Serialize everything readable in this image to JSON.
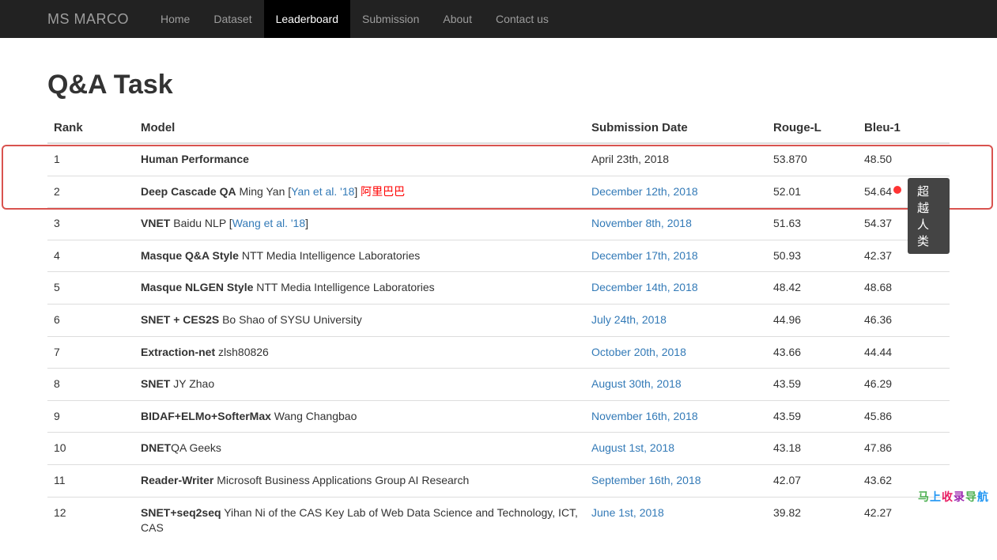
{
  "brand": "MS MARCO",
  "nav": [
    {
      "label": "Home",
      "active": false
    },
    {
      "label": "Dataset",
      "active": false
    },
    {
      "label": "Leaderboard",
      "active": true
    },
    {
      "label": "Submission",
      "active": false
    },
    {
      "label": "About",
      "active": false
    },
    {
      "label": "Contact us",
      "active": false
    }
  ],
  "page_title": "Q&A Task",
  "columns": {
    "rank": "Rank",
    "model": "Model",
    "date": "Submission Date",
    "rouge": "Rouge-L",
    "bleu": "Bleu-1"
  },
  "rows": [
    {
      "rank": "1",
      "model_name": "Human Performance",
      "model_rest": "",
      "paper": "",
      "extra_cn": "",
      "date": "April 23th, 2018",
      "date_link": false,
      "rouge": "53.870",
      "bleu": "48.50"
    },
    {
      "rank": "2",
      "model_name": "Deep Cascade QA",
      "model_rest": " Ming Yan [",
      "paper": "Yan et al. '18",
      "paper_close": "]   ",
      "extra_cn": "阿里巴巴",
      "date": "December 12th, 2018",
      "date_link": true,
      "rouge": "52.01",
      "bleu": "54.64"
    },
    {
      "rank": "3",
      "model_name": "VNET",
      "model_rest": " Baidu NLP [",
      "paper": "Wang et al. '18",
      "paper_close": "]",
      "extra_cn": "",
      "date": "November 8th, 2018",
      "date_link": true,
      "rouge": "51.63",
      "bleu": "54.37"
    },
    {
      "rank": "4",
      "model_name": "Masque Q&A Style",
      "model_rest": " NTT Media Intelligence Laboratories",
      "paper": "",
      "extra_cn": "",
      "date": "December 17th, 2018",
      "date_link": true,
      "rouge": "50.93",
      "bleu": "42.37"
    },
    {
      "rank": "5",
      "model_name": "Masque NLGEN Style",
      "model_rest": " NTT Media Intelligence Laboratories",
      "paper": "",
      "extra_cn": "",
      "date": "December 14th, 2018",
      "date_link": true,
      "rouge": "48.42",
      "bleu": "48.68"
    },
    {
      "rank": "6",
      "model_name": "SNET + CES2S",
      "model_rest": " Bo Shao of SYSU University",
      "paper": "",
      "extra_cn": "",
      "date": "July 24th, 2018",
      "date_link": true,
      "rouge": "44.96",
      "bleu": "46.36"
    },
    {
      "rank": "7",
      "model_name": "Extraction-net",
      "model_rest": " zlsh80826",
      "paper": "",
      "extra_cn": "",
      "date": "October 20th, 2018",
      "date_link": true,
      "rouge": "43.66",
      "bleu": "44.44"
    },
    {
      "rank": "8",
      "model_name": "SNET",
      "model_rest": " JY Zhao",
      "paper": "",
      "extra_cn": "",
      "date": "August 30th, 2018",
      "date_link": true,
      "rouge": "43.59",
      "bleu": "46.29"
    },
    {
      "rank": "9",
      "model_name": "BIDAF+ELMo+SofterMax",
      "model_rest": " Wang Changbao",
      "paper": "",
      "extra_cn": "",
      "date": "November 16th, 2018",
      "date_link": true,
      "rouge": "43.59",
      "bleu": "45.86"
    },
    {
      "rank": "10",
      "model_name": "DNET",
      "model_rest": "QA Geeks",
      "paper": "",
      "extra_cn": "",
      "date": "August 1st, 2018",
      "date_link": true,
      "rouge": "43.18",
      "bleu": "47.86"
    },
    {
      "rank": "11",
      "model_name": "Reader-Writer",
      "model_rest": " Microsoft Business Applications Group AI Research",
      "paper": "",
      "extra_cn": "",
      "date": "September 16th, 2018",
      "date_link": true,
      "rouge": "42.07",
      "bleu": "43.62"
    },
    {
      "rank": "12",
      "model_name": "SNET+seq2seq",
      "model_rest": " Yihan Ni of the CAS Key Lab of Web Data Science and Technology, ICT, CAS",
      "paper": "",
      "extra_cn": "",
      "date": "June 1st, 2018",
      "date_link": true,
      "rouge": "39.82",
      "bleu": "42.27"
    }
  ],
  "annotation": {
    "badge_text": "超越人类",
    "watermark": "马上收录导航"
  }
}
